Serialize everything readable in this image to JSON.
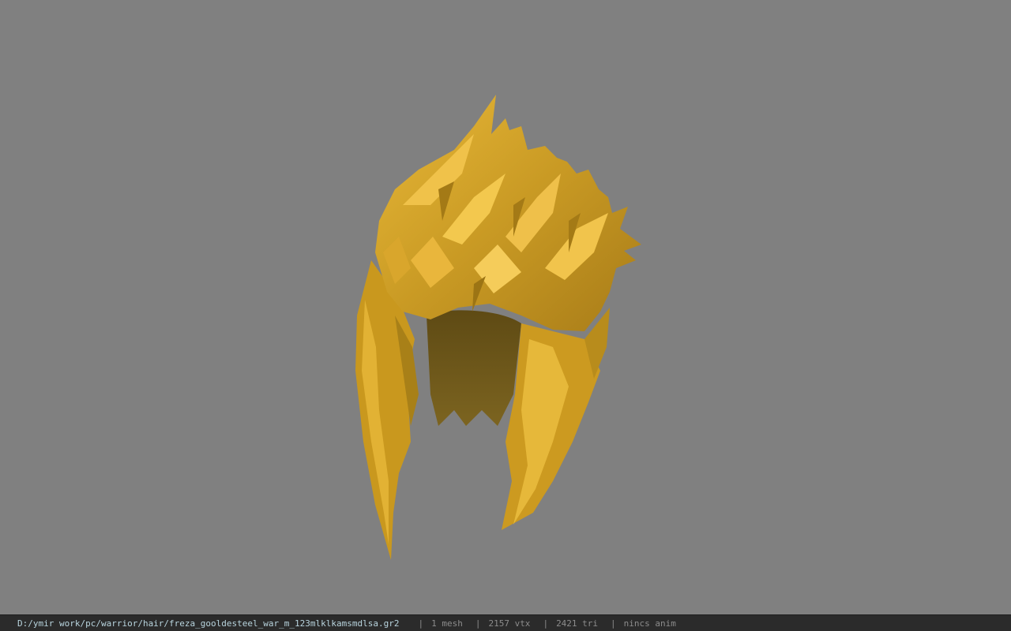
{
  "viewer": {
    "background_color": "#808080",
    "model_color": "#d9a52a",
    "model_icon": "hair-mesh-3d-model"
  },
  "statusbar": {
    "file_path": "D:/ymir work/pc/warrior/hair/freza_gooldesteel_war_m_123mlklkamsmdlsa.gr2",
    "separator": "|",
    "mesh_count": "1 mesh",
    "vertex_count": "2157 vtx",
    "triangle_count": "2421 tri",
    "animation": "nincs anim"
  }
}
